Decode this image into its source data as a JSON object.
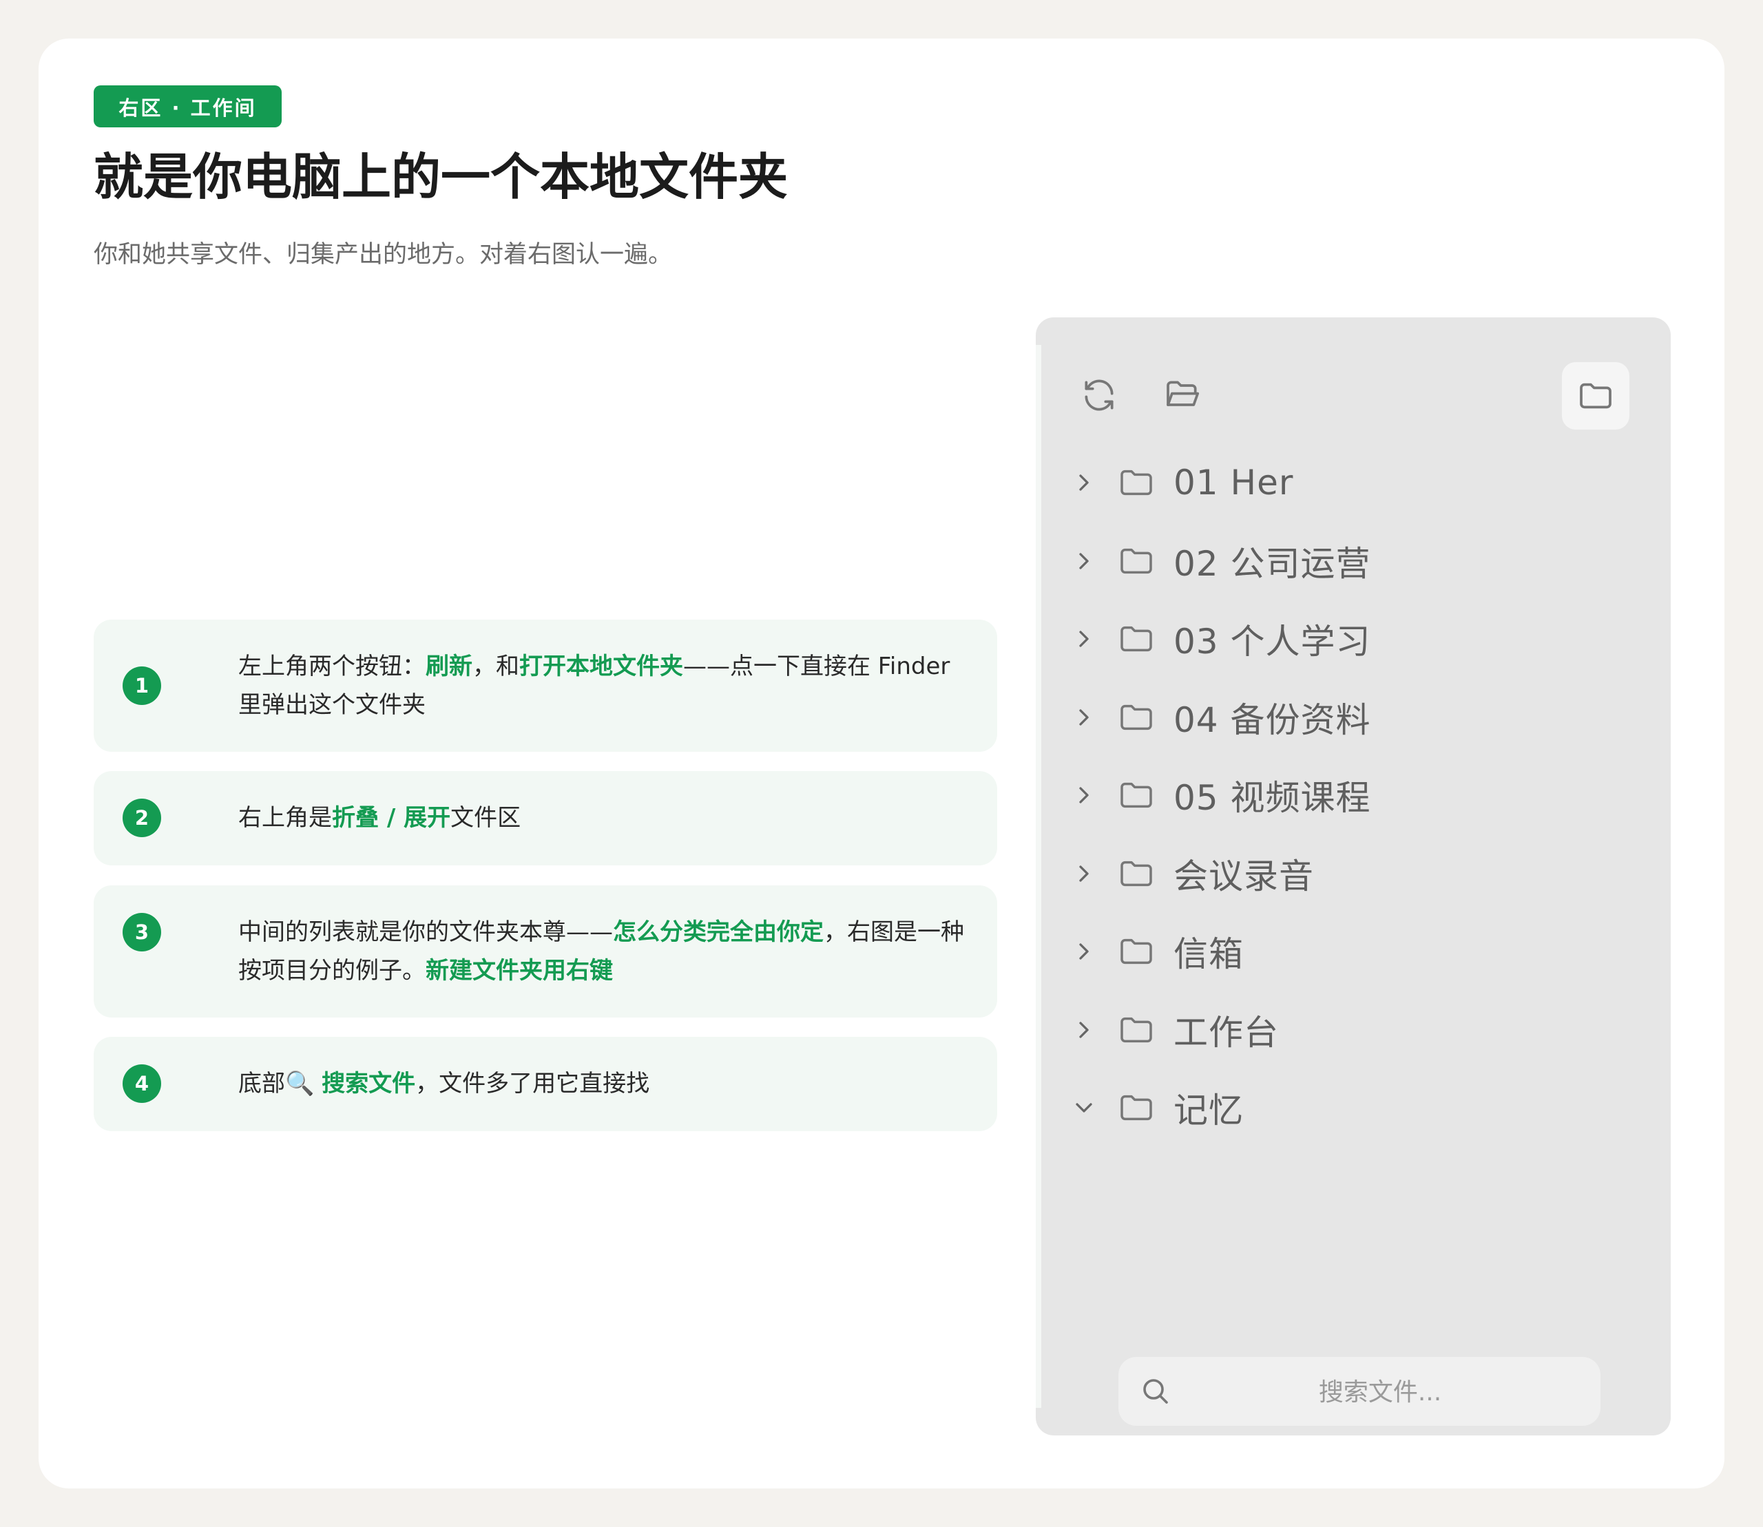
{
  "tag": "右区 · 工作间",
  "title": "就是你电脑上的一个本地文件夹",
  "subtitle": "你和她共享文件、归集产出的地方。对着右图认一遍。",
  "steps": [
    {
      "num": "1",
      "parts": [
        {
          "t": "左上角两个按钮："
        },
        {
          "t": "刷新",
          "hl": true
        },
        {
          "t": "，和"
        },
        {
          "t": "打开本地文件夹",
          "hl": true
        },
        {
          "t": "——点一下直接在 Finder 里弹出这个文件夹"
        }
      ]
    },
    {
      "num": "2",
      "parts": [
        {
          "t": "右上角是"
        },
        {
          "t": "折叠 / 展开",
          "hl": true
        },
        {
          "t": "文件区"
        }
      ]
    },
    {
      "num": "3",
      "parts": [
        {
          "t": "中间的列表就是你的文件夹本尊——"
        },
        {
          "t": "怎么分类完全由你定",
          "hl": true
        },
        {
          "t": "，右图是一种按项目分的例子。"
        },
        {
          "t": "新建文件夹用右键",
          "hl": true
        }
      ]
    },
    {
      "num": "4",
      "parts": [
        {
          "t": "底部🔍 "
        },
        {
          "t": "搜索文件",
          "hl": true
        },
        {
          "t": "，文件多了用它直接找"
        }
      ]
    }
  ],
  "panel": {
    "toolbar": {
      "refresh_icon": "refresh-icon",
      "open_folder_icon": "folder-open-icon",
      "collapse_icon": "folder-icon"
    },
    "folders": [
      {
        "label": "01 Her",
        "expanded": false
      },
      {
        "label": "02 公司运营",
        "expanded": false
      },
      {
        "label": "03 个人学习",
        "expanded": false
      },
      {
        "label": "04 备份资料",
        "expanded": false
      },
      {
        "label": "05 视频课程",
        "expanded": false
      },
      {
        "label": "会议录音",
        "expanded": false
      },
      {
        "label": "信箱",
        "expanded": false
      },
      {
        "label": "工作台",
        "expanded": false
      },
      {
        "label": "记忆",
        "expanded": true
      }
    ],
    "search": {
      "placeholder": "搜索文件...",
      "value": ""
    }
  },
  "colors": {
    "accent": "#149b52",
    "step_bg": "#f2f8f4",
    "panel_bg": "#e6e6e6",
    "page_bg": "#f4f2ee"
  }
}
